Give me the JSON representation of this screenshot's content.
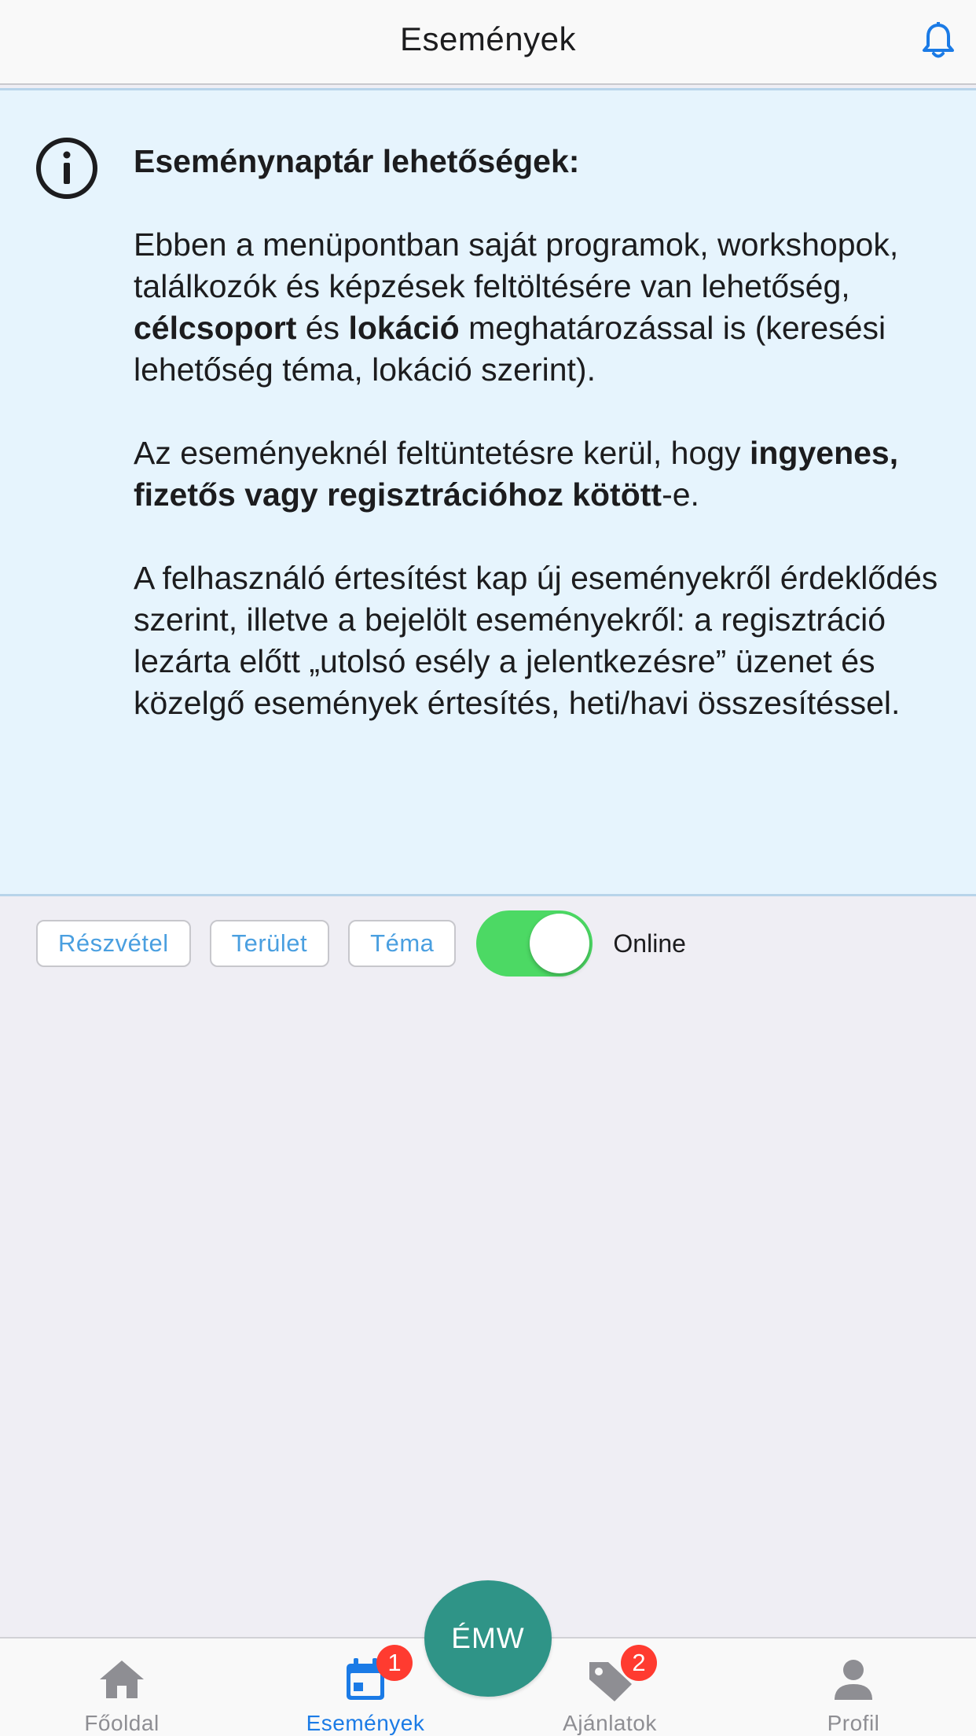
{
  "header": {
    "title": "Események",
    "bell_icon": "bell-icon"
  },
  "info": {
    "icon": "info-circle-icon",
    "heading": "Eseménynaptár lehetőségek:",
    "p1": {
      "part1": "Ebben a menüpontban saját programok, workshopok, találkozók és képzések feltöltésére van lehetőség, ",
      "bold1": "célcsoport",
      "part2": " és ",
      "bold2": "lokáció",
      "part3": " meghatározással is (keresési lehetőség téma, lokáció szerint)."
    },
    "p2": {
      "part1": "Az eseményeknél feltüntetésre kerül, hogy ",
      "bold1": "ingyenes, fizetős vagy regisztrációhoz kötött",
      "part2": "-e."
    },
    "p3": "A felhasználó értesítést kap új eseményekről érdeklődés szerint, illetve a bejelölt eseményekről: a regisztráció lezárta előtt „utolsó esély a jelentkezésre” üzenet és közelgő események értesítés, heti/havi összesítéssel."
  },
  "filters": {
    "chips": [
      "Részvétel",
      "Terület",
      "Téma"
    ],
    "toggle_label": "Online",
    "toggle_on": true
  },
  "tabbar": {
    "tabs": [
      {
        "label": "Főoldal",
        "icon": "home-icon",
        "active": false,
        "badge": ""
      },
      {
        "label": "Események",
        "icon": "calendar-icon",
        "active": true,
        "badge": "1"
      },
      {
        "label": "Ajánlatok",
        "icon": "tag-icon",
        "active": false,
        "badge": "2"
      },
      {
        "label": "Profil",
        "icon": "person-icon",
        "active": false,
        "badge": ""
      }
    ],
    "center_button": "ÉMW"
  },
  "colors": {
    "accent_blue": "#1b7be6",
    "chip_text": "#4a9fe0",
    "toggle_green": "#4cd964",
    "fab_teal": "#2f9487",
    "badge_red": "#ff3b30",
    "info_bg": "#e6f4fd"
  }
}
